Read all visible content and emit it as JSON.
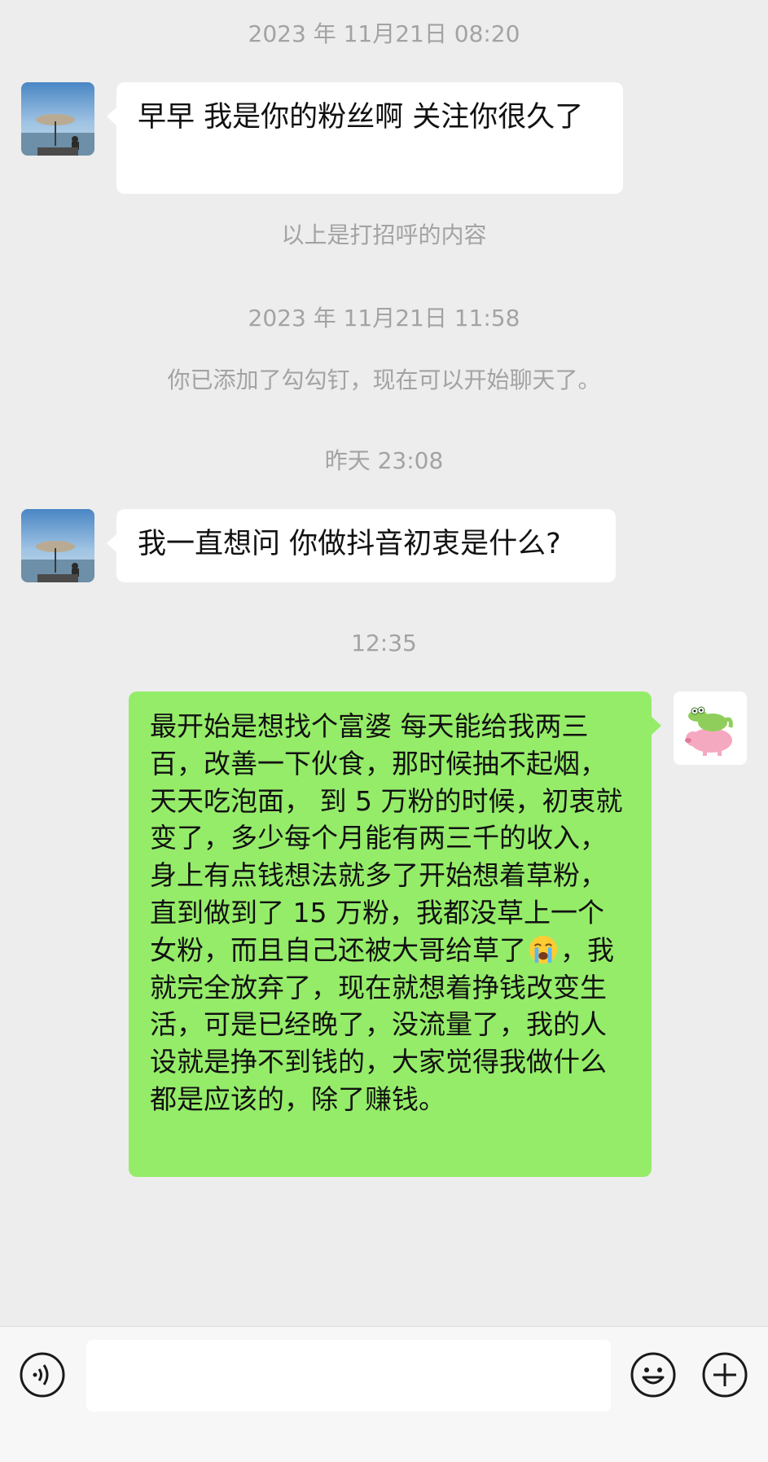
{
  "messages": {
    "time1": "2023 年 11月21日 08:20",
    "msg1": "早早  我是你的粉丝啊  关注你很久了",
    "greeting_note": "以上是打招呼的内容",
    "time2": "2023 年 11月21日 11:58",
    "added_note": "你已添加了勾勾钉，现在可以开始聊天了。",
    "time3": "昨天 23:08",
    "msg2": "我一直想问 你做抖音初衷是什么?",
    "time4": "12:35",
    "reply_part1": "最开始是想找个富婆 每天能给我两三百，改善一下伙食，那时候抽不起烟，天天吃泡面， 到 5 万粉的时候，初衷就变了，多少每个月能有两三千的收入，身上有点钱想法就多了开始想着草粉，直到做到了 15 万粉，我都没草上一个女粉，而且自己还被大哥给草了",
    "reply_emoji": "loudly-crying-face-emoji",
    "reply_part2": "，我就完全放弃了，现在就想着挣钱改变生活，可是已经晚了，没流量了，我的人设就是挣不到钱的，大家觉得我做什么都是应该的，除了赚钱。"
  },
  "contact_avatar": "beach-umbrella-photo",
  "my_avatar": "pig-and-crocodile-sticker",
  "input": {
    "value": "",
    "voice_icon": "voice-icon",
    "emoji_icon": "emoji-icon",
    "plus_icon": "plus-icon"
  },
  "colors": {
    "background": "#ededed",
    "my_bubble": "#95ec69",
    "their_bubble": "#ffffff",
    "system_text": "#a3a3a3"
  }
}
